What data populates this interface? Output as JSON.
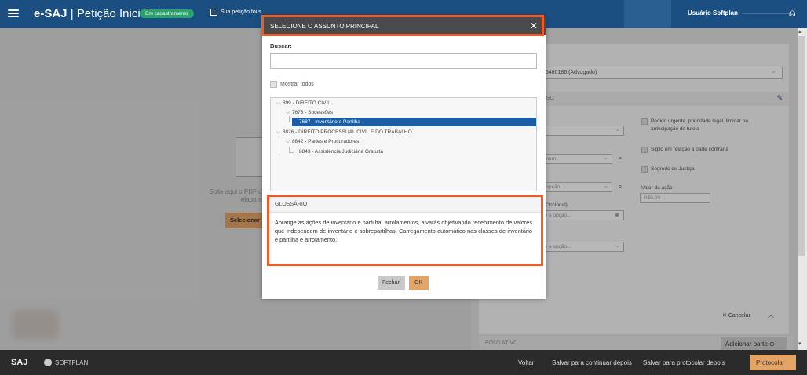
{
  "header": {
    "app_name": "e-SAJ",
    "page_title": "Petição Inicial",
    "status_badge": "Em cadastramento",
    "save_indicator": "Sua petição foi s",
    "user_name": "Usuário Softplan"
  },
  "left_panel": {
    "drop_text_line1": "Solte aqui o PDF de",
    "drop_text_line2": "elaborad",
    "select_button": "Selecionar"
  },
  "right_panel": {
    "lawyer_select": "05460186 (Advogado)",
    "section_label": "SSO",
    "field_comum": "omum",
    "field_opcao1": "a opção...",
    "field_opcional_label": "Opcional)",
    "field_opcao2": "ne a opção...",
    "field_opcao3": "ne a opção...",
    "check_urgente": "Pedido urgente, prioridade legal, liminar ou antecipação de tutela",
    "check_sigilo": "Sigilo em relação à parte contrária",
    "check_segredo": "Segredo de Justiça",
    "valor_label": "Valor da ação",
    "valor_placeholder": "R$0.00",
    "cancel_label": "Cancelar",
    "polo_label": "POLO ATIVO",
    "add_part_label": "Adicionar parte"
  },
  "modal": {
    "title": "SELECIONE O ASSUNTO PRINCIPAL",
    "search_label": "Buscar:",
    "search_value": "",
    "show_all_label": "Mostrar todos",
    "tree": [
      {
        "label": "899 - DIREITO CIVIL",
        "level": 0,
        "expanded": true
      },
      {
        "label": "7673 - Sucessões",
        "level": 1,
        "expanded": true
      },
      {
        "label": "7687 - Inventário e Partilha",
        "level": 2,
        "selected": true
      },
      {
        "label": "8826 - DIREITO PROCESSUAL CIVIL E DO TRABALHO",
        "level": 0,
        "expanded": true
      },
      {
        "label": "8842 - Partes e Procuradores",
        "level": 1,
        "expanded": true
      },
      {
        "label": "8843 - Assistência Judiciária Gratuita",
        "level": 2
      }
    ],
    "glossary_title": "GLOSSÁRIO",
    "glossary_text": "Abrange as ações de inventário e partilha, arrolamentos, alvarás objetivando recebimento de valores que independem de inventário e sobrepartilhas. Carregamento automático nas classes de inventário e partilha e arrolamento.",
    "close_button": "Fechar",
    "ok_button": "OK"
  },
  "footer": {
    "saj_logo": "SAJ",
    "softplan_logo": "SOFTPLAN",
    "back": "Voltar",
    "save_continue": "Salvar para continuar depois",
    "save_protocol": "Salvar para protocolar depois",
    "protocol": "Protocolar"
  },
  "colors": {
    "topbar": "#1b4f82",
    "accent_orange": "#e3a466",
    "highlight_outline": "#f05a28",
    "tree_selected": "#1b5ea6",
    "badge_green": "#2aa26c"
  }
}
